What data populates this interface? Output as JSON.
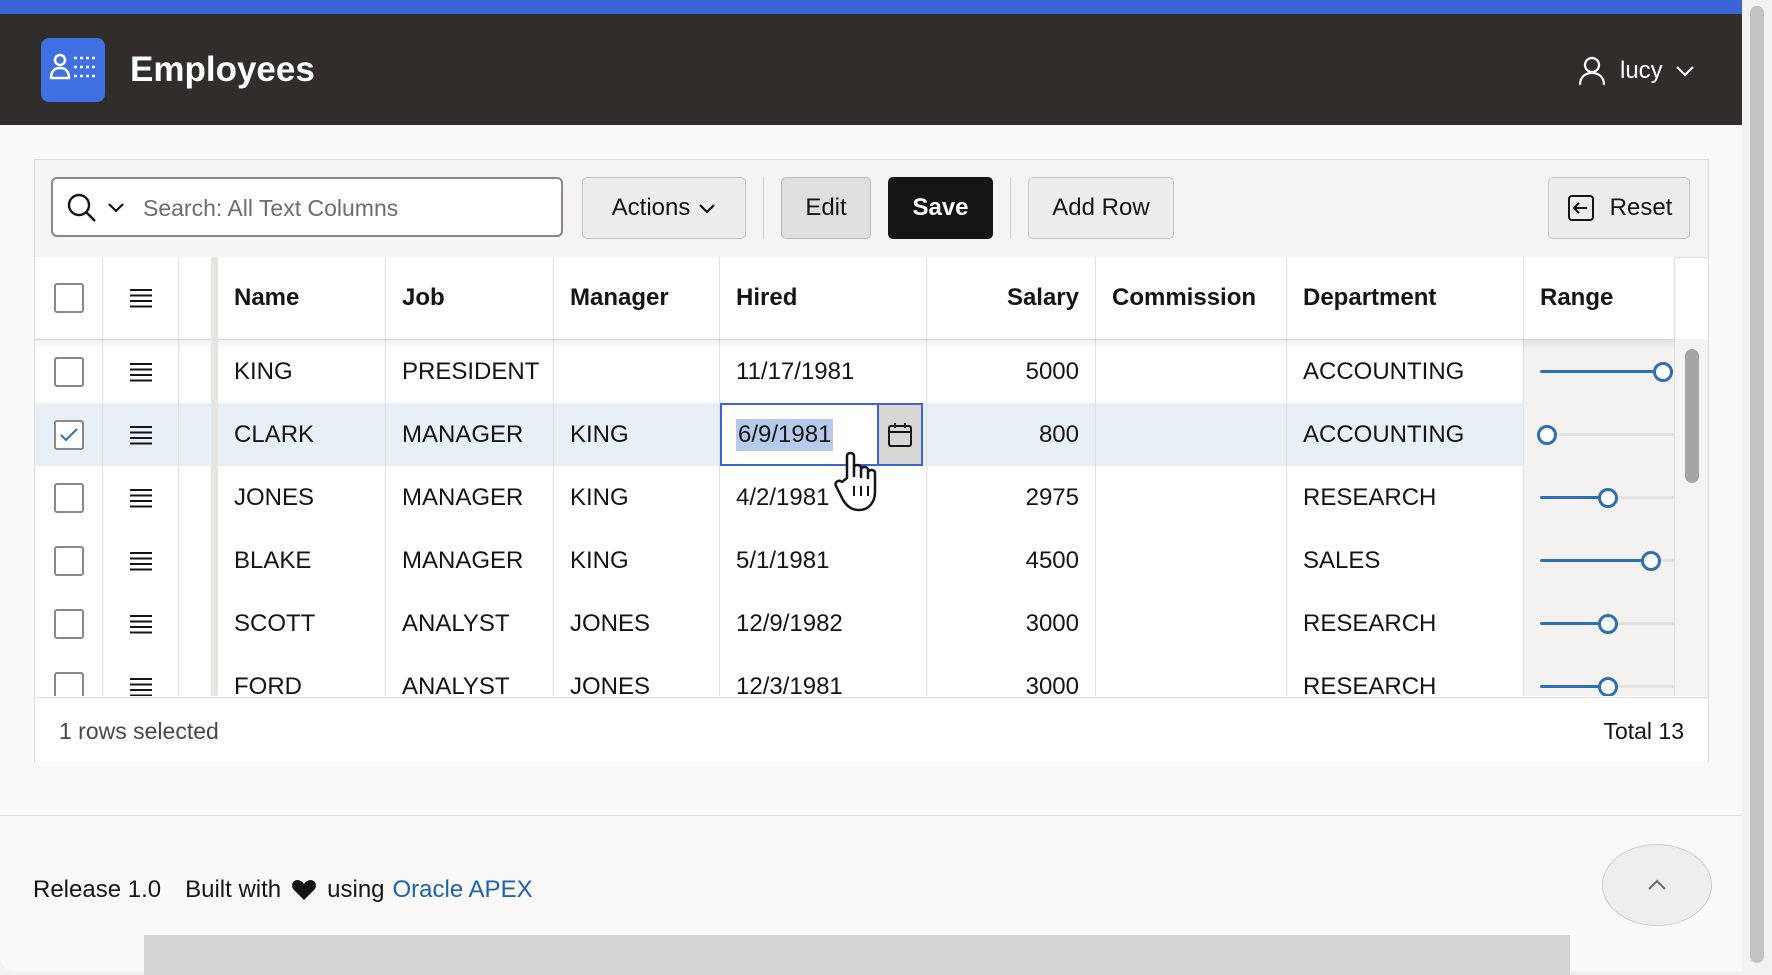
{
  "app": {
    "title": "Employees",
    "user": "lucy"
  },
  "toolbar": {
    "search_placeholder": "Search: All Text Columns",
    "actions_label": "Actions",
    "edit_label": "Edit",
    "save_label": "Save",
    "add_row_label": "Add Row",
    "reset_label": "Reset"
  },
  "columns": {
    "name": "Name",
    "job": "Job",
    "manager": "Manager",
    "hired": "Hired",
    "salary": "Salary",
    "commission": "Commission",
    "department": "Department",
    "range": "Range"
  },
  "rows": [
    {
      "name": "KING",
      "job": "PRESIDENT",
      "manager": "",
      "hired": "11/17/1981",
      "salary": "5000",
      "commission": "",
      "department": "ACCOUNTING",
      "range": 0.83,
      "selected": false
    },
    {
      "name": "CLARK",
      "job": "MANAGER",
      "manager": "KING",
      "hired": "6/9/1981",
      "salary": "800",
      "commission": "",
      "department": "ACCOUNTING",
      "range": 0.05,
      "selected": true
    },
    {
      "name": "JONES",
      "job": "MANAGER",
      "manager": "KING",
      "hired": "4/2/1981",
      "salary": "2975",
      "commission": "",
      "department": "RESEARCH",
      "range": 0.46,
      "selected": false
    },
    {
      "name": "BLAKE",
      "job": "MANAGER",
      "manager": "KING",
      "hired": "5/1/1981",
      "salary": "4500",
      "commission": "",
      "department": "SALES",
      "range": 0.75,
      "selected": false
    },
    {
      "name": "SCOTT",
      "job": "ANALYST",
      "manager": "JONES",
      "hired": "12/9/1982",
      "salary": "3000",
      "commission": "",
      "department": "RESEARCH",
      "range": 0.46,
      "selected": false
    },
    {
      "name": "FORD",
      "job": "ANALYST",
      "manager": "JONES",
      "hired": "12/3/1981",
      "salary": "3000",
      "commission": "",
      "department": "RESEARCH",
      "range": 0.46,
      "selected": false
    }
  ],
  "status": {
    "selected_text": "1 rows selected",
    "total_text": "Total 13"
  },
  "footer": {
    "release": "Release 1.0",
    "built_with": "Built with",
    "using": "using",
    "link": "Oracle APEX"
  },
  "colors": {
    "accent": "#3b64d6",
    "header_bg": "#312d2a",
    "link": "#1c62b0",
    "slider": "#2e6fb3",
    "selected_row": "#e8f0f7"
  }
}
